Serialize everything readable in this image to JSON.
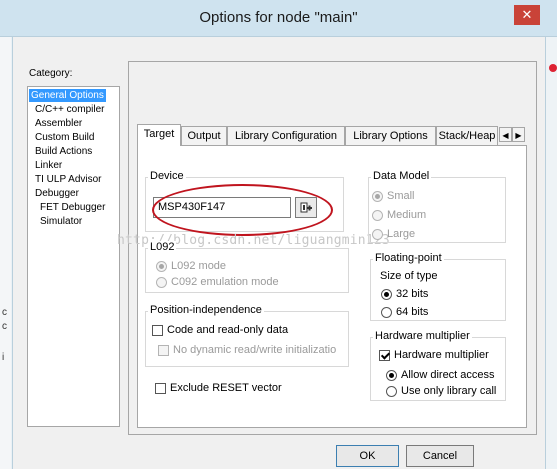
{
  "window": {
    "title": "Options for node \"main\"",
    "close_glyph": "✕"
  },
  "background_fragments": [
    "c",
    "c",
    "i"
  ],
  "category": {
    "label": "Category:",
    "items": [
      {
        "label": "General Options",
        "selected": true
      },
      {
        "label": "C/C++ compiler"
      },
      {
        "label": "Assembler"
      },
      {
        "label": "Custom Build"
      },
      {
        "label": "Build Actions"
      },
      {
        "label": "Linker"
      },
      {
        "label": "TI ULP Advisor"
      },
      {
        "label": "Debugger"
      },
      {
        "label": "FET Debugger"
      },
      {
        "label": "Simulator"
      }
    ]
  },
  "tabs": [
    {
      "label": "Target",
      "active": true
    },
    {
      "label": "Output"
    },
    {
      "label": "Library Configuration"
    },
    {
      "label": "Library Options"
    },
    {
      "label": "Stack/Heap"
    }
  ],
  "tab_scroll": {
    "left": "◀",
    "right": "▶"
  },
  "device": {
    "title": "Device",
    "value": "MSP430F147",
    "browse_icon": "device-select-icon"
  },
  "l092": {
    "title": "L092",
    "options": [
      {
        "label": "L092 mode",
        "checked": true,
        "disabled": true
      },
      {
        "label": "C092 emulation mode",
        "checked": false,
        "disabled": true
      }
    ]
  },
  "position_independence": {
    "title": "Position-independence",
    "code_readonly": {
      "label": "Code and read-only data",
      "checked": false
    },
    "no_dynamic": {
      "label": "No dynamic read/write initializatio",
      "checked": false,
      "disabled": true
    }
  },
  "exclude_reset": {
    "label": "Exclude RESET vector",
    "checked": false
  },
  "data_model": {
    "title": "Data Model",
    "options": [
      {
        "label": "Small",
        "checked": true,
        "disabled": true
      },
      {
        "label": "Medium",
        "checked": false,
        "disabled": true
      },
      {
        "label": "Large",
        "checked": false,
        "disabled": true
      }
    ]
  },
  "floating_point": {
    "title": "Floating-point",
    "size_label": "Size of type",
    "options": [
      {
        "label": "32 bits",
        "checked": true
      },
      {
        "label": "64 bits",
        "checked": false
      }
    ]
  },
  "hardware_multiplier": {
    "title": "Hardware multiplier",
    "checkbox": {
      "label": "Hardware multiplier",
      "checked": true
    },
    "options": [
      {
        "label": "Allow direct access",
        "checked": true
      },
      {
        "label": "Use only library call",
        "checked": false
      }
    ]
  },
  "watermark": "http://blog.csdn.net/liguangmin123",
  "buttons": {
    "ok": "OK",
    "cancel": "Cancel"
  },
  "colors": {
    "selection": "#3399ff",
    "annotation": "#c0141e",
    "titlebar": "#cfe3ef"
  }
}
